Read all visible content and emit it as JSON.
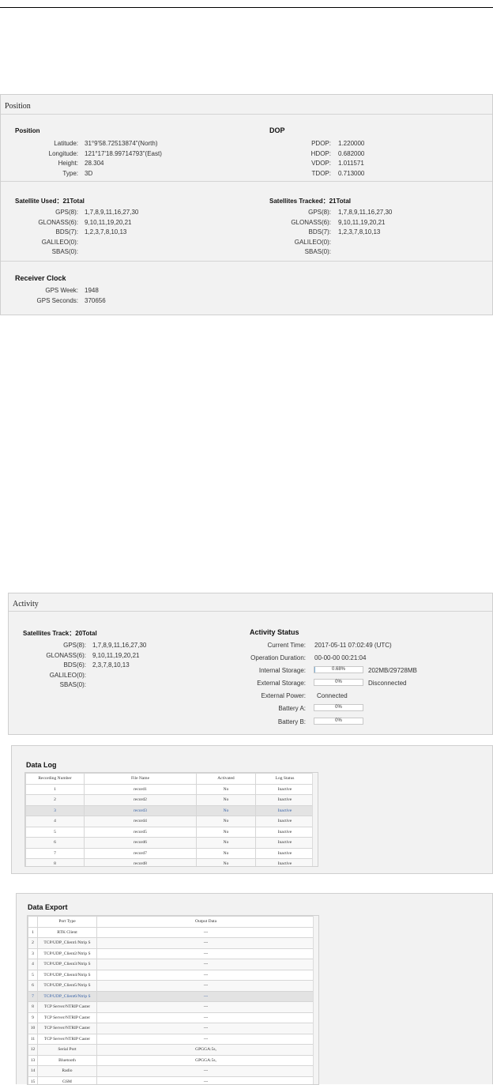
{
  "position_panel": {
    "title": "Position",
    "position": {
      "header": "Position",
      "rows": [
        {
          "label": "Latitude:",
          "value": "31°9'58.72513874\"(North)"
        },
        {
          "label": "Longitude:",
          "value": "121°17'18.99714793\"(East)"
        },
        {
          "label": "Height:",
          "value": "28.304"
        },
        {
          "label": "Type:",
          "value": "3D"
        }
      ]
    },
    "dop": {
      "header": "DOP",
      "rows": [
        {
          "label": "PDOP:",
          "value": "1.220000"
        },
        {
          "label": "HDOP:",
          "value": "0.682000"
        },
        {
          "label": "VDOP:",
          "value": "1.011571"
        },
        {
          "label": "TDOP:",
          "value": "0.713000"
        }
      ]
    },
    "sat_used": {
      "header": "Satellite Used：21Total",
      "rows": [
        {
          "label": "GPS(8):",
          "value": "1,7,8,9,11,16,27,30"
        },
        {
          "label": "GLONASS(6):",
          "value": "9,10,11,19,20,21"
        },
        {
          "label": "BDS(7):",
          "value": "1,2,3,7,8,10,13"
        },
        {
          "label": "GALILEO(0):",
          "value": ""
        },
        {
          "label": "SBAS(0):",
          "value": ""
        }
      ]
    },
    "sat_tracked": {
      "header": "Satellites Tracked：21Total",
      "rows": [
        {
          "label": "GPS(8):",
          "value": "1,7,8,9,11,16,27,30"
        },
        {
          "label": "GLONASS(6):",
          "value": "9,10,11,19,20,21"
        },
        {
          "label": "BDS(7):",
          "value": "1,2,3,7,8,10,13"
        },
        {
          "label": "GALILEO(0):",
          "value": ""
        },
        {
          "label": "SBAS(0):",
          "value": ""
        }
      ]
    },
    "clock": {
      "header": "Receiver Clock",
      "rows": [
        {
          "label": "GPS Week:",
          "value": "1948"
        },
        {
          "label": "GPS Seconds:",
          "value": "370656"
        }
      ]
    }
  },
  "activity_panel": {
    "title": "Activity",
    "sat_track": {
      "header": "Satellites Track：20Total",
      "rows": [
        {
          "label": "GPS(8):",
          "value": "1,7,8,9,11,16,27,30"
        },
        {
          "label": "GLONASS(6):",
          "value": "9,10,11,19,20,21"
        },
        {
          "label": "BDS(6):",
          "value": "2,3,7,8,10,13"
        },
        {
          "label": "GALILEO(0):",
          "value": ""
        },
        {
          "label": "SBAS(0):",
          "value": ""
        }
      ]
    },
    "status": {
      "header": "Activity Status",
      "current_time_label": "Current Time:",
      "current_time": "2017-05-11 07:02:49 (UTC)",
      "duration_label": "Operation Duration:",
      "duration": "00-00-00 00:21:04",
      "internal_label": "Internal Storage:",
      "internal_pct": "0.68%",
      "internal_fraction": 0.0068,
      "internal_size": "202MB/29728MB",
      "external_label": "External Storage:",
      "external_pct": "0%",
      "external_status": "Disconnected",
      "power_label": "External Power:",
      "power_value": "Connected",
      "battery_a_label": "Battery A:",
      "battery_a": "0%",
      "battery_b_label": "Battery B:",
      "battery_b": "0%"
    }
  },
  "data_log": {
    "title": "Data Log",
    "columns": [
      "Recording Number",
      "File Name",
      "Activated",
      "Log Status"
    ],
    "rows": [
      [
        "1",
        "record1",
        "No",
        "Inactive"
      ],
      [
        "2",
        "record2",
        "No",
        "Inactive"
      ],
      [
        "3",
        "record3",
        "No",
        "Inactive"
      ],
      [
        "4",
        "record4",
        "No",
        "Inactive"
      ],
      [
        "5",
        "record5",
        "No",
        "Inactive"
      ],
      [
        "6",
        "record6",
        "No",
        "Inactive"
      ],
      [
        "7",
        "record7",
        "No",
        "Inactive"
      ],
      [
        "8",
        "record8",
        "No",
        "Inactive"
      ]
    ],
    "selected_row": 2
  },
  "data_export": {
    "title": "Data Export",
    "columns": [
      "",
      "Port Type",
      "Output Data"
    ],
    "rows": [
      [
        "1",
        "RTK Client",
        "---"
      ],
      [
        "2",
        "TCP/UDP_Client1/Ntrip S",
        "---"
      ],
      [
        "3",
        "TCP/UDP_Client2/Ntrip S",
        "---"
      ],
      [
        "4",
        "TCP/UDP_Client3/Ntrip S",
        "---"
      ],
      [
        "5",
        "TCP/UDP_Client4/Ntrip S",
        "---"
      ],
      [
        "6",
        "TCP/UDP_Client5/Ntrip S",
        "---"
      ],
      [
        "7",
        "TCP/UDP_Client6/Ntrip S",
        "---"
      ],
      [
        "8",
        "TCP Server/NTRIP Caster",
        "---"
      ],
      [
        "9",
        "TCP Server/NTRIP Caster",
        "---"
      ],
      [
        "10",
        "TCP Server/NTRIP Caster",
        "---"
      ],
      [
        "11",
        "TCP Server/NTRIP Caster",
        "---"
      ],
      [
        "12",
        "Serial Port",
        "GPGGA:5s,"
      ],
      [
        "13",
        "Bluetooth",
        "GPGGA:5s,"
      ],
      [
        "14",
        "Radio",
        "---"
      ],
      [
        "15",
        "GSM",
        "---"
      ]
    ],
    "selected_row": 6
  }
}
